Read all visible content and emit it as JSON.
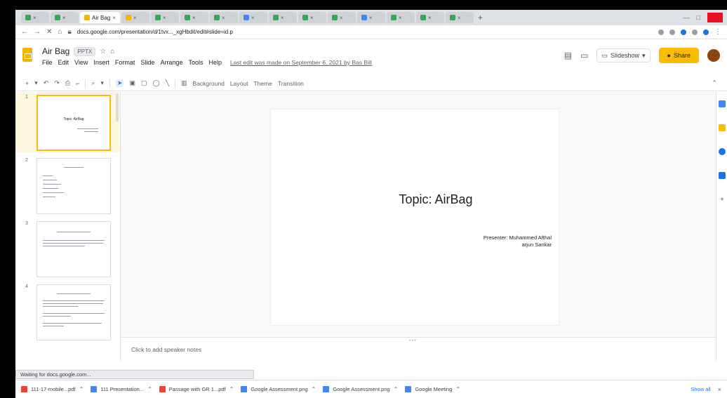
{
  "browser": {
    "tabs": [
      {
        "label": "Air Bag",
        "active": true
      }
    ],
    "url": "docs.google.com/presentation/d/1tvx..._xgHbdit/edit#slide=id.p"
  },
  "doc": {
    "title": "Air Bag",
    "ext_badge": "PPTX",
    "menu": [
      "File",
      "Edit",
      "View",
      "Insert",
      "Format",
      "Slide",
      "Arrange",
      "Tools",
      "Help"
    ],
    "last_edit": "Last edit was made on September 6, 2021 by Bas Bill",
    "slideshow_label": "Slideshow",
    "share_label": "Share"
  },
  "toolbar": {
    "background": "Background",
    "layout": "Layout",
    "theme": "Theme",
    "transition": "Transition"
  },
  "filmstrip": {
    "numbers": [
      "1",
      "2",
      "3",
      "4"
    ],
    "slide1_title": "Topic: AirBag"
  },
  "slide": {
    "title": "Topic: AirBag",
    "subtitle_line1": "Presenter: Muhammed Afthal",
    "subtitle_line2": "arjun Sankar"
  },
  "notes": {
    "placeholder": "Click to add speaker notes"
  },
  "status": {
    "text": "Waiting for docs.google.com..."
  },
  "downloads": {
    "items": [
      {
        "name": "111-17-mobile...pdf",
        "type": "pdf"
      },
      {
        "name": "111 Presentation...",
        "type": "doc"
      },
      {
        "name": "Passage with GR 1...pdf",
        "type": "pdf"
      },
      {
        "name": "Google Assessment.png",
        "type": "img"
      },
      {
        "name": "Google Assessment.png",
        "type": "img"
      },
      {
        "name": "Google Meeting",
        "type": "img"
      }
    ],
    "show_all": "Show all"
  }
}
